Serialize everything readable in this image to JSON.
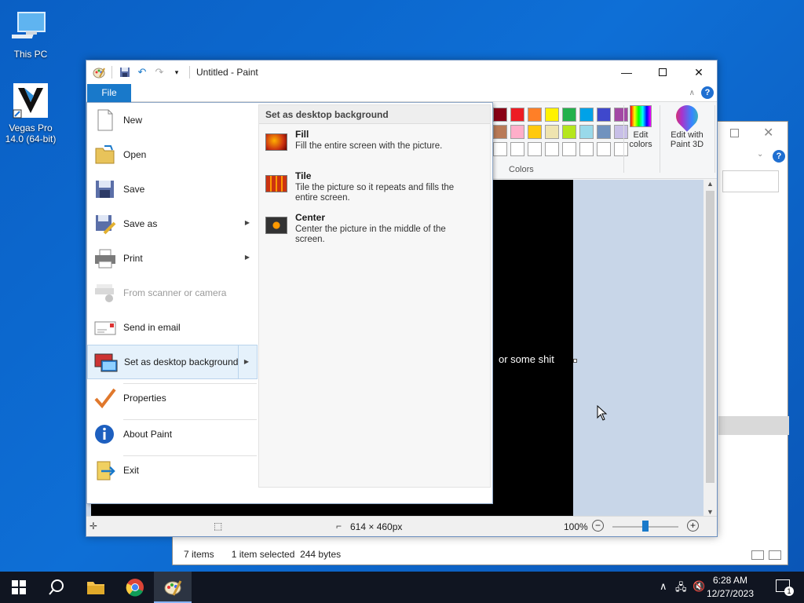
{
  "desktop": {
    "icons": [
      {
        "label": "This PC"
      },
      {
        "label": "Vegas Pro 14.0 (64-bit)"
      }
    ]
  },
  "explorer": {
    "status_items": "7 items",
    "status_selected": "1 item selected",
    "status_size": "244 bytes",
    "help_glyph": "?"
  },
  "paint": {
    "title": "Untitled - Paint",
    "file_tab": "File",
    "help_glyph": "?",
    "colors_label": "Colors",
    "edit_colors_label": "Edit colors",
    "paint3d_label": "Edit with Paint 3D",
    "canvas_text": "or some shit",
    "status_dims": "614 × 460px",
    "zoom_level": "100%",
    "zoom_fraction": 0.5,
    "palette": [
      "#880015",
      "#ed1c24",
      "#ff7f27",
      "#fff200",
      "#22b14c",
      "#00a2e8",
      "#3f48cc",
      "#a349a4",
      "#b97a57",
      "#ffaec9",
      "#ffc90e",
      "#efe4b0",
      "#b5e61d",
      "#99d9ea",
      "#7092be",
      "#c8bfe7",
      "#ffffff",
      "#ffffff",
      "#ffffff",
      "#ffffff",
      "#ffffff",
      "#ffffff",
      "#ffffff",
      "#ffffff"
    ]
  },
  "file_menu": {
    "items": [
      {
        "label": "New"
      },
      {
        "label": "Open"
      },
      {
        "label": "Save"
      },
      {
        "label": "Save as"
      },
      {
        "label": "Print"
      },
      {
        "label": "From scanner or camera"
      },
      {
        "label": "Send in email"
      },
      {
        "label": "Set as desktop background"
      },
      {
        "label": "Properties"
      },
      {
        "label": "About Paint"
      },
      {
        "label": "Exit"
      }
    ],
    "submenu": {
      "header": "Set as desktop background",
      "options": [
        {
          "title": "Fill",
          "desc": "Fill the entire screen with the picture."
        },
        {
          "title": "Tile",
          "desc": "Tile the picture so it repeats and fills the entire screen."
        },
        {
          "title": "Center",
          "desc": "Center the picture in the middle of the screen."
        }
      ]
    }
  },
  "taskbar": {
    "time": "6:28 AM",
    "date": "12/27/2023",
    "notifications": "1"
  }
}
